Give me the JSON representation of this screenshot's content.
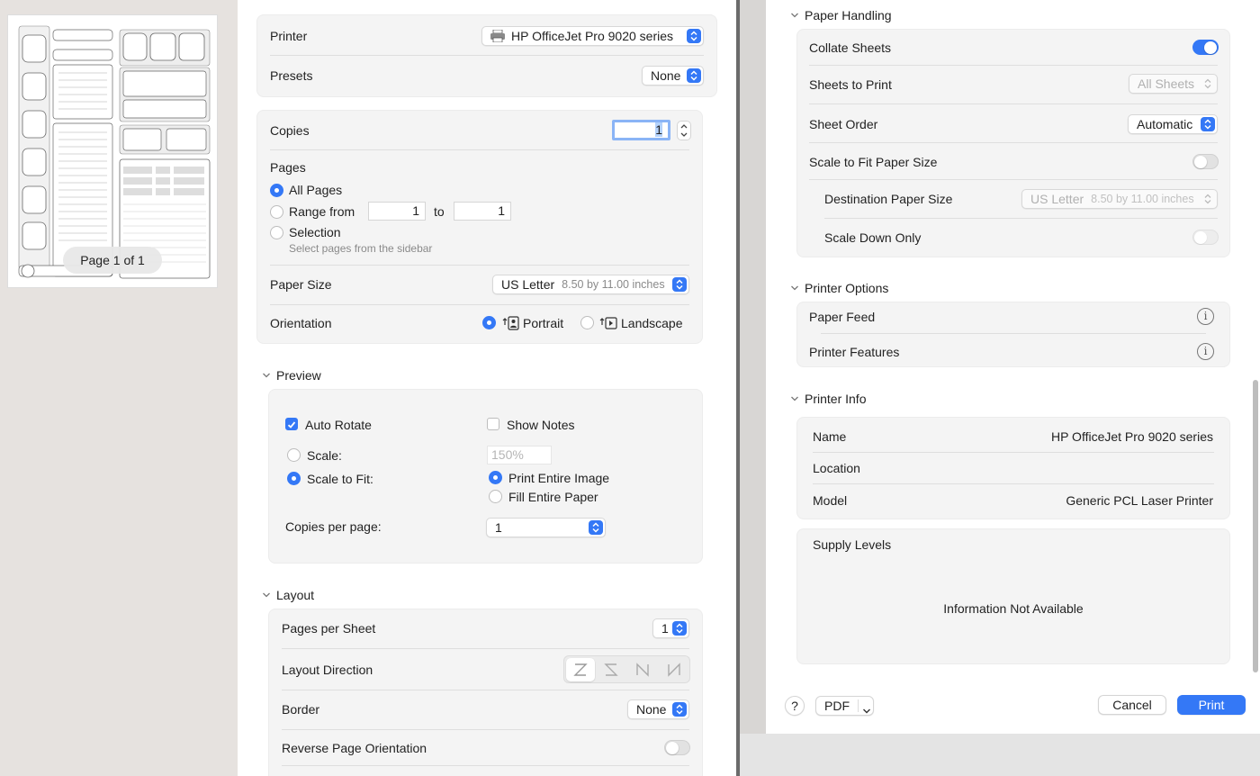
{
  "thumbnail": {
    "page_label": "Page 1 of 1"
  },
  "left": {
    "printer_label": "Printer",
    "printer_value": "HP OfficeJet Pro 9020 series",
    "presets_label": "Presets",
    "presets_value": "None",
    "copies_label": "Copies",
    "copies_value": "1",
    "pages_label": "Pages",
    "all_pages": "All Pages",
    "range_from": "Range from",
    "range_from_value": "1",
    "range_to": "to",
    "range_to_value": "1",
    "selection": "Selection",
    "selection_hint": "Select pages from the sidebar",
    "paper_size_label": "Paper Size",
    "paper_size_value": "US Letter",
    "paper_size_dims": "8.50 by 11.00 inches",
    "orientation_label": "Orientation",
    "portrait": "Portrait",
    "landscape": "Landscape",
    "preview_section": "Preview",
    "auto_rotate": "Auto Rotate",
    "show_notes": "Show Notes",
    "scale": "Scale:",
    "scale_value": "150%",
    "scale_to_fit": "Scale to Fit:",
    "print_entire_image": "Print Entire Image",
    "fill_entire_paper": "Fill Entire Paper",
    "copies_per_page": "Copies per page:",
    "copies_per_page_value": "1",
    "layout_section": "Layout",
    "pages_per_sheet": "Pages per Sheet",
    "pages_per_sheet_value": "1",
    "layout_direction": "Layout Direction",
    "border": "Border",
    "border_value": "None",
    "reverse_orientation": "Reverse Page Orientation"
  },
  "right": {
    "paper_handling_section": "Paper Handling",
    "collate_sheets": "Collate Sheets",
    "sheets_to_print": "Sheets to Print",
    "sheets_to_print_value": "All Sheets",
    "sheet_order": "Sheet Order",
    "sheet_order_value": "Automatic",
    "scale_to_fit_paper": "Scale to Fit Paper Size",
    "destination_paper_size": "Destination Paper Size",
    "destination_value": "US Letter",
    "destination_dims": "8.50 by 11.00 inches",
    "scale_down_only": "Scale Down Only",
    "printer_options_section": "Printer Options",
    "paper_feed": "Paper Feed",
    "printer_features": "Printer Features",
    "printer_info_section": "Printer Info",
    "name_label": "Name",
    "name_value": "HP OfficeJet Pro 9020 series",
    "location_label": "Location",
    "model_label": "Model",
    "model_value": "Generic PCL Laser Printer",
    "supply_levels": "Supply Levels",
    "info_not_available": "Information Not Available"
  },
  "footer": {
    "help": "?",
    "pdf": "PDF",
    "cancel": "Cancel",
    "print": "Print"
  },
  "colors": {
    "accent": "#3478f6"
  }
}
